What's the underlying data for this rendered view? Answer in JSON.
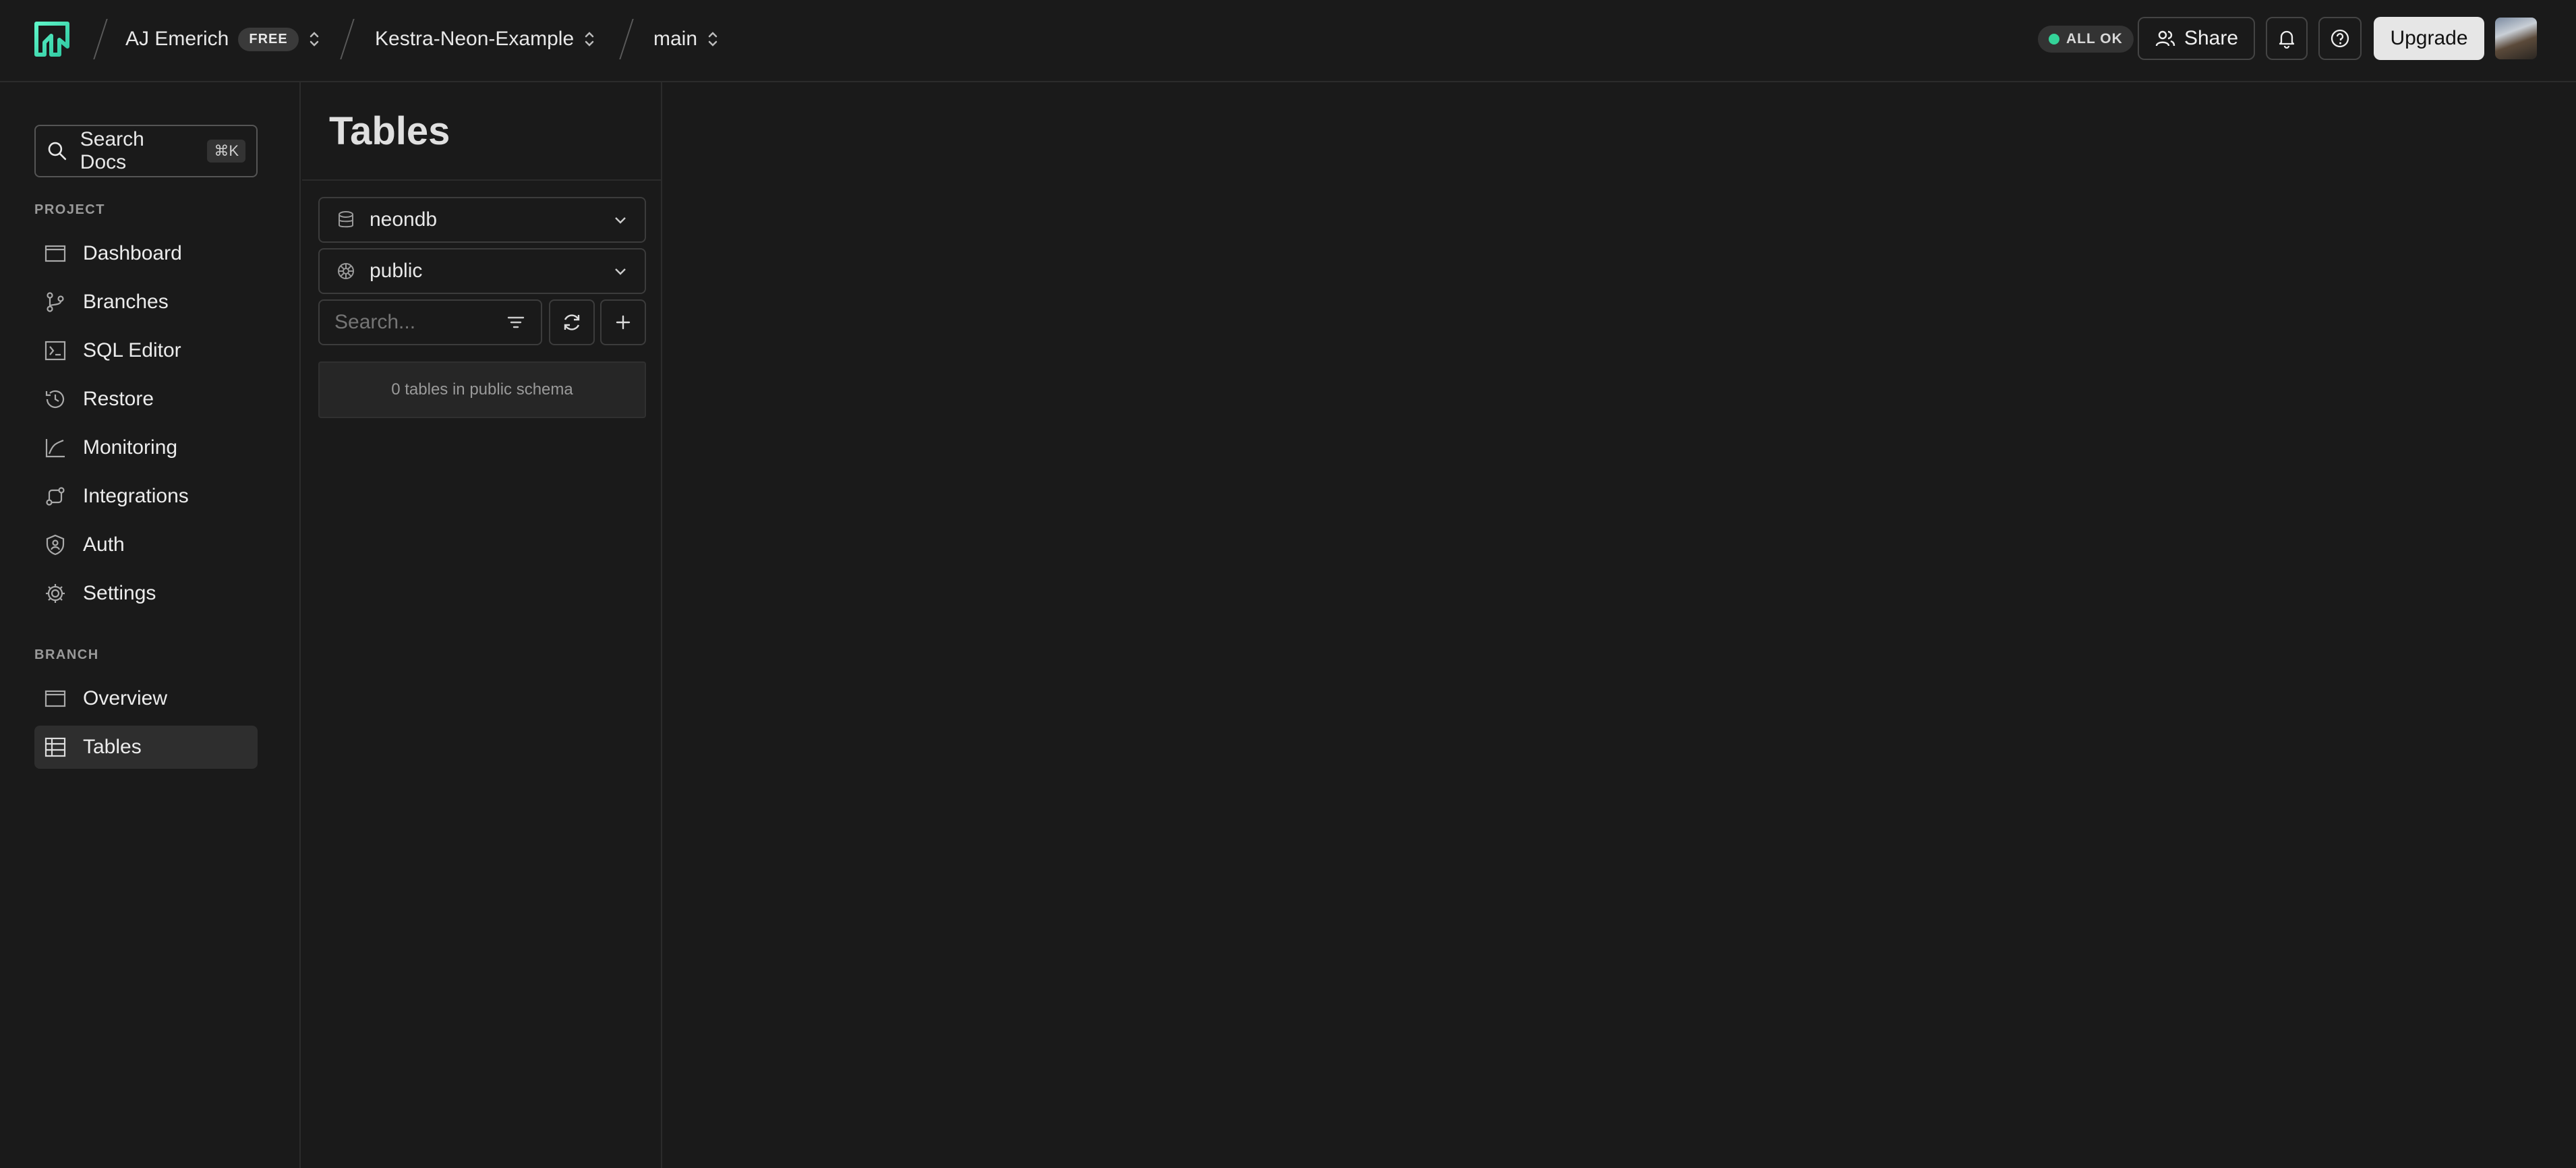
{
  "header": {
    "org": {
      "name": "AJ Emerich",
      "plan_badge": "FREE"
    },
    "project": {
      "name": "Kestra-Neon-Example"
    },
    "branch": {
      "name": "main"
    },
    "status": {
      "label": "ALL OK",
      "color": "#34d399"
    },
    "share_label": "Share",
    "upgrade_label": "Upgrade",
    "icons": [
      "neon-logo-icon",
      "users-icon",
      "bell-icon",
      "help-icon",
      "avatar"
    ]
  },
  "sidebar": {
    "search": {
      "label": "Search Docs",
      "shortcut": "⌘K"
    },
    "project_section": "PROJECT",
    "project_items": [
      {
        "label": "Dashboard",
        "icon": "dashboard-icon"
      },
      {
        "label": "Branches",
        "icon": "branches-icon"
      },
      {
        "label": "SQL Editor",
        "icon": "sql-editor-icon"
      },
      {
        "label": "Restore",
        "icon": "restore-icon"
      },
      {
        "label": "Monitoring",
        "icon": "monitoring-icon"
      },
      {
        "label": "Integrations",
        "icon": "integrations-icon"
      },
      {
        "label": "Auth",
        "icon": "auth-icon"
      },
      {
        "label": "Settings",
        "icon": "settings-icon"
      }
    ],
    "branch_section": "BRANCH",
    "branch_items": [
      {
        "label": "Overview",
        "icon": "overview-icon"
      },
      {
        "label": "Tables",
        "icon": "tables-icon",
        "active": true
      }
    ]
  },
  "tables_panel": {
    "title": "Tables",
    "database_select": "neondb",
    "schema_select": "public",
    "search_placeholder": "Search...",
    "empty_message": "0 tables in public schema"
  }
}
